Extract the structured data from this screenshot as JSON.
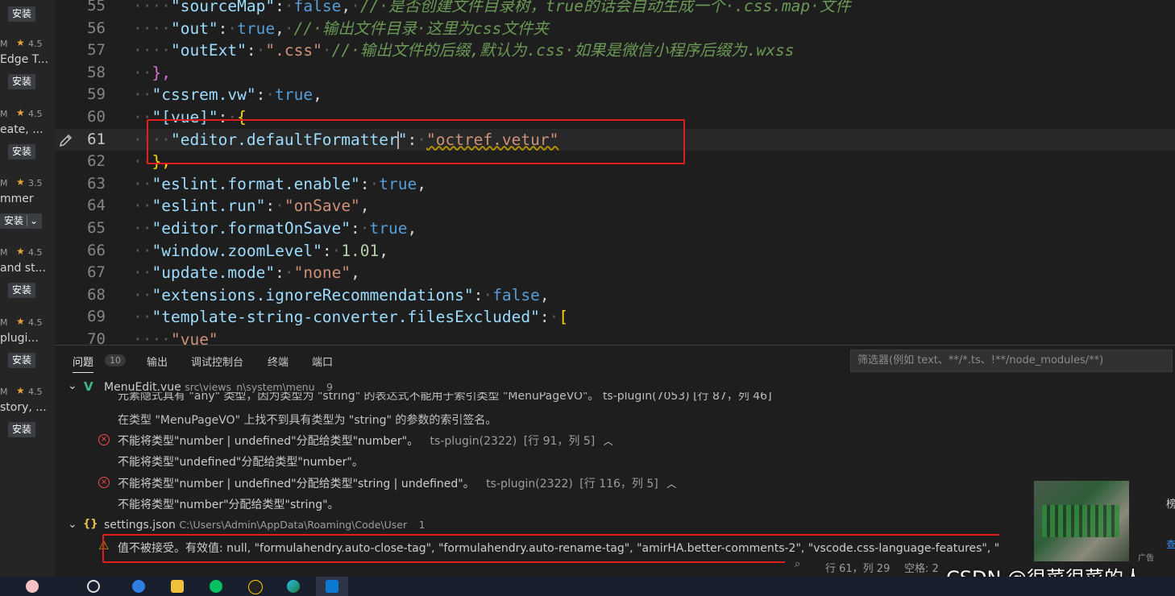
{
  "extensions": [
    {
      "meta_m": "",
      "rating": "",
      "name": "",
      "install": "安装"
    },
    {
      "meta_m": "M",
      "rating": "4.5",
      "name": "Edge T...",
      "install": "安装"
    },
    {
      "meta_m": "M",
      "rating": "4.5",
      "name": "eate, ...",
      "install": "安装"
    },
    {
      "meta_m": "M",
      "rating": "3.5",
      "name": "mmer",
      "install": "安装"
    },
    {
      "meta_m": "M",
      "rating": "4.5",
      "name": "and st...",
      "install": "安装"
    },
    {
      "meta_m": "M",
      "rating": "4.5",
      "name": "plugi...",
      "install": "安装"
    },
    {
      "meta_m": "M",
      "rating": "4.5",
      "name": "story, ...",
      "install": "安装"
    }
  ],
  "editor": {
    "line_numbers": [
      "55",
      "56",
      "57",
      "58",
      "59",
      "60",
      "61",
      "62",
      "63",
      "64",
      "65",
      "66",
      "67",
      "68",
      "69",
      "70"
    ],
    "lines": {
      "l55_key": "\"sourceMap\"",
      "l55_val": "false",
      "l55_comment": "//·是否创建文件目录树，true的话会自动生成一个·.css.map·文件",
      "l56_key": "\"out\"",
      "l56_val": "true",
      "l56_comment": "//·输出文件目录·这里为css文件夹",
      "l57_key": "\"outExt\"",
      "l57_val": "\".css\"",
      "l57_comment": "//·输出文件的后缀,默认为.css·如果是微信小程序后缀为.wxss",
      "l58": "},",
      "l59_key": "\"cssrem.vw\"",
      "l59_val": "true",
      "l60_key": "\"[vue]\"",
      "l61_key_a": "\"editor.",
      "l61_key_b": "defaultFormatter",
      "l61_key_c": "\"",
      "l61_val": "\"octref.vetur\"",
      "l62": "},",
      "l63_key": "\"eslint.format.enable\"",
      "l63_val": "true",
      "l64_key": "\"eslint.run\"",
      "l64_val": "\"onSave\"",
      "l65_key": "\"editor.formatOnSave\"",
      "l65_val": "true",
      "l66_key": "\"window.zoomLevel\"",
      "l66_val": "1.01",
      "l67_key": "\"update.mode\"",
      "l67_val": "\"none\"",
      "l68_key": "\"extensions.ignoreRecommendations\"",
      "l68_val": "false",
      "l69_key": "\"template-string-converter.filesExcluded\"",
      "l70_val": "\"vue\""
    }
  },
  "panel": {
    "tabs": [
      {
        "label": "问题",
        "count": "10"
      },
      {
        "label": "输出"
      },
      {
        "label": "调试控制台"
      },
      {
        "label": "终端"
      },
      {
        "label": "端口"
      }
    ],
    "filter_placeholder": "筛选器(例如 text、**/*.ts、!**/node_modules/**)",
    "file1": {
      "name": "MenuEdit.vue",
      "path": "src\\views_n\\system\\menu",
      "count": "9"
    },
    "partial_row": "元素隐式具有 \"any\" 类型，因为类型为 \"string\" 的表达式不能用于索引类型 \"MenuPageVO\"。  ts-plugin(7053)  [行 87，列 46]",
    "problems": [
      {
        "msg": "在类型 \"MenuPageVO\" 上找不到具有类型为 \"string\" 的参数的索引签名。"
      },
      {
        "msg": "不能将类型\"number | undefined\"分配给类型\"number\"。",
        "src": "ts-plugin(2322)",
        "loc": "[行 91，列 5]"
      },
      {
        "msg": "不能将类型\"undefined\"分配给类型\"number\"。"
      },
      {
        "msg": "不能将类型\"number | undefined\"分配给类型\"string | undefined\"。",
        "src": "ts-plugin(2322)",
        "loc": "[行 116，列 5]"
      },
      {
        "msg": "不能将类型\"number\"分配给类型\"string\"。"
      }
    ],
    "file2": {
      "name": "settings.json",
      "path": "C:\\Users\\Admin\\AppData\\Roaming\\Code\\User",
      "count": "1"
    },
    "warning": "值不被接受。有效值: null, \"formulahendry.auto-close-tag\", \"formulahendry.auto-rename-tag\", \"amirHA.better-comments-2\", \"vscode.css-language-features\", \"v"
  },
  "statusbar": {
    "position": "行 61，列 29",
    "spaces": "空格: 2"
  },
  "ad": {
    "title": "榜",
    "more": "查",
    "label": "广告"
  },
  "watermark": "CSDN @很菜很菜的人",
  "taskbar": {
    "apps": [
      "app-1",
      "search",
      "app-translate",
      "file-explorer",
      "wechat",
      "qq",
      "edge",
      "vscode"
    ]
  },
  "colors": {
    "accent_red": "#e01e1e",
    "error": "#f14c4c",
    "warning": "#cca700",
    "vue_green": "#41b883"
  }
}
